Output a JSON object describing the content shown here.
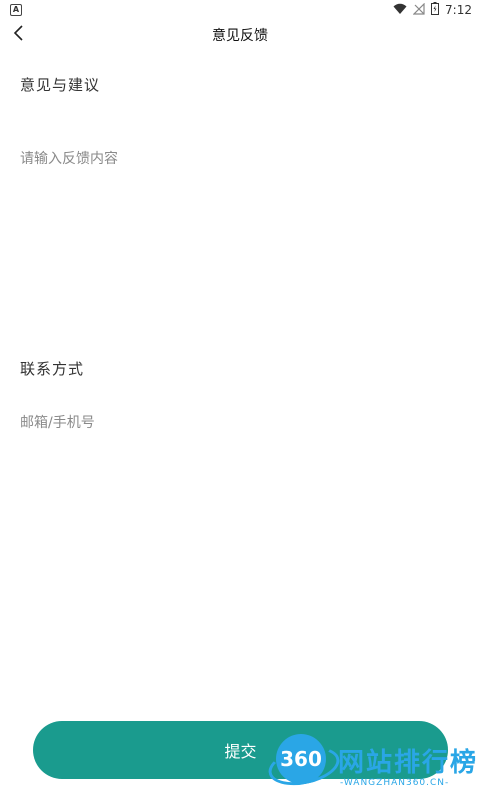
{
  "status_bar": {
    "app_badge": "A",
    "time": "7:12"
  },
  "header": {
    "title": "意见反馈"
  },
  "form": {
    "feedback_label": "意见与建议",
    "feedback_placeholder": "请输入反馈内容",
    "feedback_value": "",
    "contact_label": "联系方式",
    "contact_placeholder": "邮箱/手机号",
    "contact_value": ""
  },
  "submit_label": "提交",
  "watermark": {
    "logo_number": "360",
    "brand": "网站排行榜",
    "site": "-WANGZHAN360.CN-"
  },
  "colors": {
    "accent": "#1a9b8e",
    "watermark": "#2aa6e6"
  },
  "icons": {
    "back": "chevron-left-icon",
    "wifi": "wifi-icon",
    "signal": "no-signal-icon",
    "battery": "battery-icon"
  }
}
